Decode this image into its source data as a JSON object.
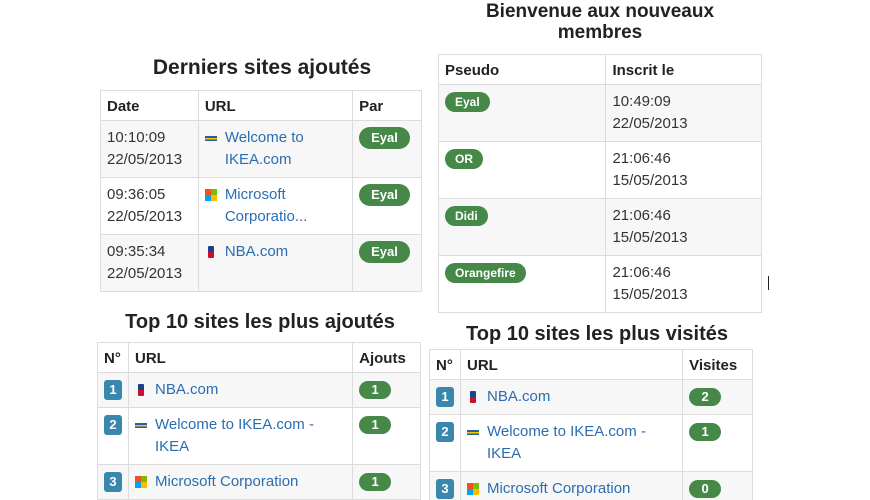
{
  "latest_sites": {
    "title": "Derniers sites ajoutés",
    "headers": {
      "date": "Date",
      "url": "URL",
      "by": "Par"
    },
    "rows": [
      {
        "time": "10:10:09",
        "date": "22/05/2013",
        "favicon": "ikea-icon",
        "url_text": "Welcome to IKEA.com",
        "by": "Eyal"
      },
      {
        "time": "09:36:05",
        "date": "22/05/2013",
        "favicon": "microsoft-icon",
        "url_text": "Microsoft Corporatio...",
        "by": "Eyal"
      },
      {
        "time": "09:35:34",
        "date": "22/05/2013",
        "favicon": "nba-icon",
        "url_text": "NBA.com",
        "by": "Eyal"
      }
    ]
  },
  "new_members": {
    "title": "Bienvenue aux nouveaux membres",
    "headers": {
      "pseudo": "Pseudo",
      "registered": "Inscrit le"
    },
    "rows": [
      {
        "pseudo": "Eyal",
        "time": "10:49:09",
        "date": "22/05/2013"
      },
      {
        "pseudo": "OR",
        "time": "21:06:46",
        "date": "15/05/2013"
      },
      {
        "pseudo": "Didi",
        "time": "21:06:46",
        "date": "15/05/2013"
      },
      {
        "pseudo": "Orangefire",
        "time": "21:06:46",
        "date": "15/05/2013"
      }
    ]
  },
  "top_added": {
    "title": "Top 10 sites les plus ajoutés",
    "headers": {
      "rank": "N°",
      "url": "URL",
      "count": "Ajouts"
    },
    "rows": [
      {
        "rank": "1",
        "favicon": "nba-icon",
        "url_text": "NBA.com",
        "count": "1"
      },
      {
        "rank": "2",
        "favicon": "ikea-icon",
        "url_text": "Welcome to IKEA.com - IKEA",
        "count": "1"
      },
      {
        "rank": "3",
        "favicon": "microsoft-icon",
        "url_text": "Microsoft Corporation",
        "count": "1"
      }
    ]
  },
  "top_visited": {
    "title": "Top 10 sites les plus visités",
    "headers": {
      "rank": "N°",
      "url": "URL",
      "count": "Visites"
    },
    "rows": [
      {
        "rank": "1",
        "favicon": "nba-icon",
        "url_text": "NBA.com",
        "count": "2"
      },
      {
        "rank": "2",
        "favicon": "ikea-icon",
        "url_text": "Welcome to IKEA.com - IKEA",
        "count": "1"
      },
      {
        "rank": "3",
        "favicon": "microsoft-icon",
        "url_text": "Microsoft Corporation",
        "count": "0"
      }
    ]
  },
  "colors": {
    "badge_green": "#468847",
    "rank_blue": "#3a87ad",
    "link_blue": "#2a6db0"
  }
}
